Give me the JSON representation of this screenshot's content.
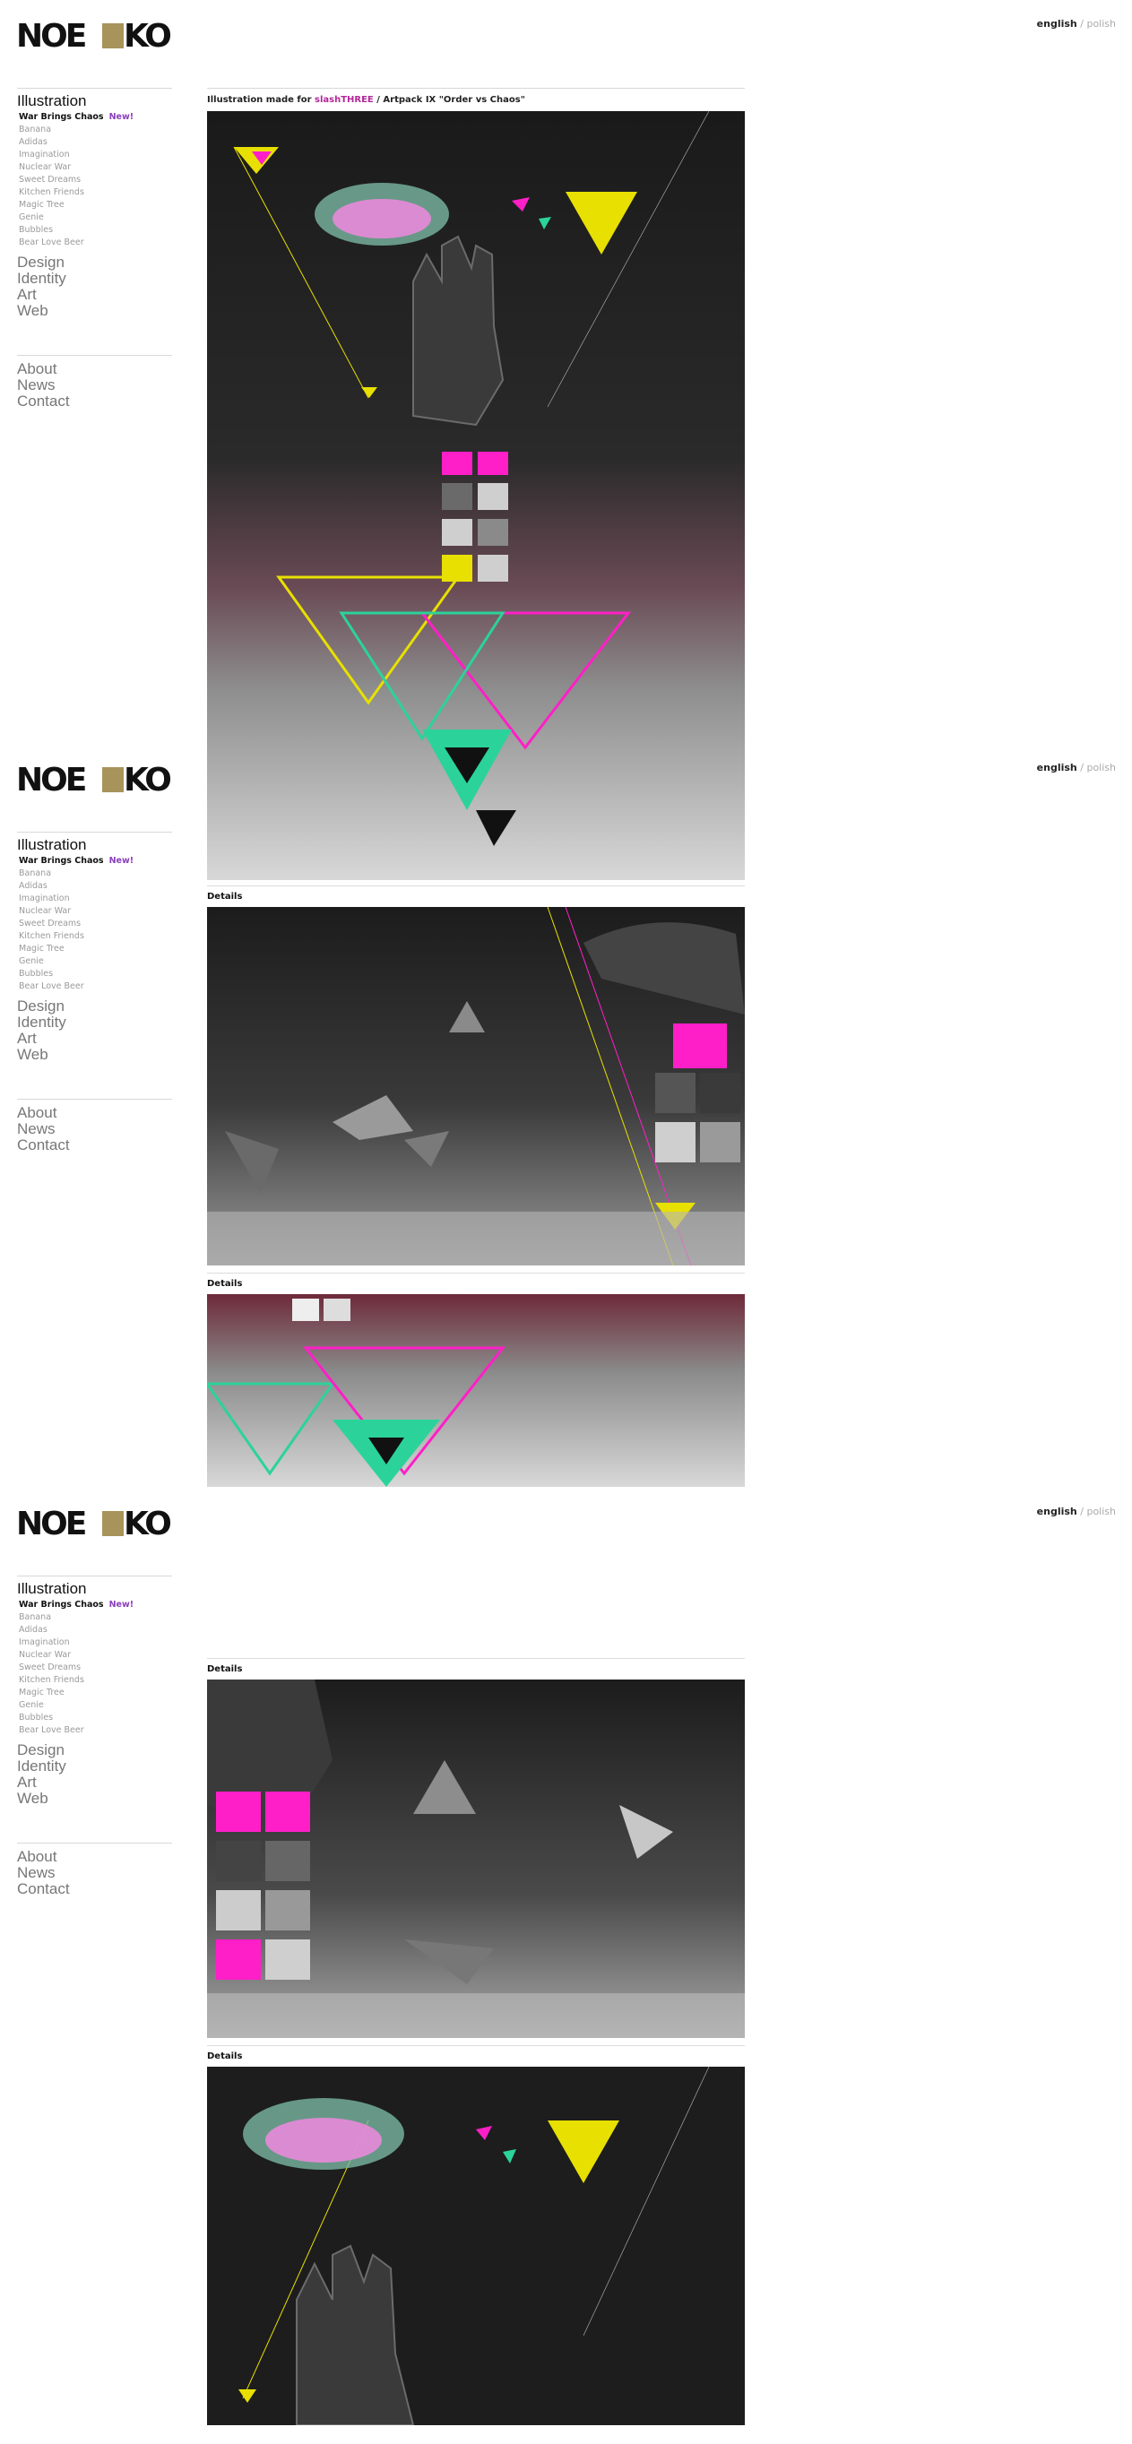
{
  "brand": {
    "logo_text": "NOEEKO"
  },
  "lang": {
    "active": "english",
    "separator": "/",
    "inactive": "polish"
  },
  "sidebar": {
    "category": "Illustration",
    "items": [
      {
        "label": "War Brings Chaos",
        "badge": "New!"
      },
      {
        "label": "Banana"
      },
      {
        "label": "Adidas"
      },
      {
        "label": "Imagination"
      },
      {
        "label": "Nuclear War"
      },
      {
        "label": "Sweet Dreams"
      },
      {
        "label": "Kitchen Friends"
      },
      {
        "label": "Magic Tree"
      },
      {
        "label": "Genie"
      },
      {
        "label": "Bubbles"
      },
      {
        "label": "Bear Love Beer"
      }
    ],
    "main_nav": [
      "Design",
      "Identity",
      "Art",
      "Web"
    ],
    "secondary_nav": [
      "About",
      "News",
      "Contact"
    ]
  },
  "content": {
    "caption_prefix": "Illustration made for ",
    "caption_link": "slashTHREE",
    "caption_suffix": " / Artpack IX \"Order vs Chaos\"",
    "details_label": "Details"
  },
  "colors": {
    "magenta": "#ff1fc8",
    "yellow": "#e8e000",
    "teal": "#2bd39a",
    "dark": "#1c1c1c"
  }
}
